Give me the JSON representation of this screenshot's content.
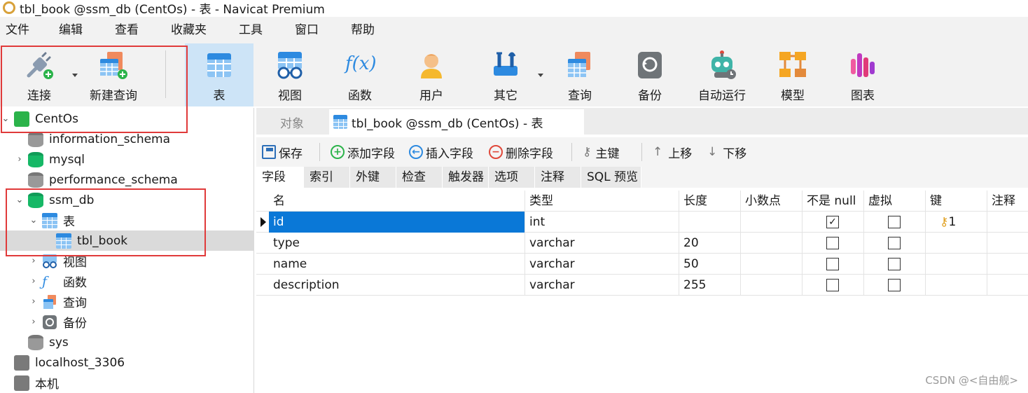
{
  "window": {
    "title": "tbl_book @ssm_db (CentOs) - 表 - Navicat Premium"
  },
  "menu": [
    "文件",
    "编辑",
    "查看",
    "收藏夹",
    "工具",
    "窗口",
    "帮助"
  ],
  "toolbar": {
    "connect": "连接",
    "new_query": "新建查询",
    "table": "表",
    "view": "视图",
    "function": "函数",
    "user": "用户",
    "other": "其它",
    "query": "查询",
    "backup": "备份",
    "automation": "自动运行",
    "model": "模型",
    "chart": "图表",
    "function_glyph": "f(x)"
  },
  "tree": {
    "centos": "CentOs",
    "information_schema": "information_schema",
    "mysql": "mysql",
    "performance_schema": "performance_schema",
    "ssm_db": "ssm_db",
    "tables": "表",
    "tbl_book": "tbl_book",
    "views": "视图",
    "functions": "函数",
    "queries": "查询",
    "backups": "备份",
    "sys": "sys",
    "localhost": "localhost_3306",
    "local": "本机"
  },
  "object_tabs": {
    "objects": "对象",
    "current": "tbl_book @ssm_db (CentOs) - 表"
  },
  "actions": {
    "save": "保存",
    "add_field": "添加字段",
    "insert_field": "插入字段",
    "delete_field": "删除字段",
    "primary_key": "主键",
    "move_up": "上移",
    "move_down": "下移"
  },
  "subtabs": [
    "字段",
    "索引",
    "外键",
    "检查",
    "触发器",
    "选项",
    "注释",
    "SQL 预览"
  ],
  "grid": {
    "headers": {
      "name": "名",
      "type": "类型",
      "length": "长度",
      "decimals": "小数点",
      "not_null": "不是 null",
      "virtual": "虚拟",
      "key": "键",
      "comment": "注释"
    },
    "rows": [
      {
        "name": "id",
        "type": "int",
        "length": "",
        "not_null": true,
        "virtual": false,
        "key": "1"
      },
      {
        "name": "type",
        "type": "varchar",
        "length": "20",
        "not_null": false,
        "virtual": false,
        "key": ""
      },
      {
        "name": "name",
        "type": "varchar",
        "length": "50",
        "not_null": false,
        "virtual": false,
        "key": ""
      },
      {
        "name": "description",
        "type": "varchar",
        "length": "255",
        "not_null": false,
        "virtual": false,
        "key": ""
      }
    ]
  },
  "watermark": "CSDN @<自由舰>",
  "colors": {
    "selection": "#0a78d7",
    "highlight_box": "#e03a3a",
    "active_tool": "#cde4f7"
  }
}
